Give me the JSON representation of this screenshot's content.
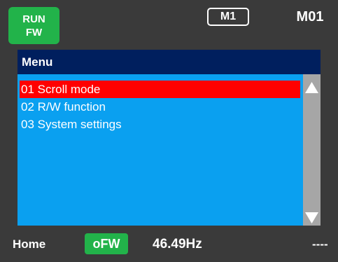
{
  "header": {
    "run_state_line1": "RUN",
    "run_state_line2": "FW",
    "mode": "M1",
    "model": "M01"
  },
  "menu": {
    "title": "Menu",
    "items": [
      {
        "label": "01 Scroll mode",
        "selected": true
      },
      {
        "label": "02 R/W function",
        "selected": false
      },
      {
        "label": "03 System settings",
        "selected": false
      }
    ]
  },
  "scrollbar": {
    "up_icon": "triangle-up-icon",
    "down_icon": "triangle-down-icon"
  },
  "status": {
    "location": "Home",
    "direction": "oFW",
    "frequency": "46.49Hz",
    "extra": "----"
  },
  "colors": {
    "background": "#3a3a3a",
    "green": "#22b34a",
    "header_navy": "#001f5e",
    "list_blue": "#0aa0f0",
    "selection_red": "#ff0000",
    "scrollbar_gray": "#a6a6a6"
  }
}
